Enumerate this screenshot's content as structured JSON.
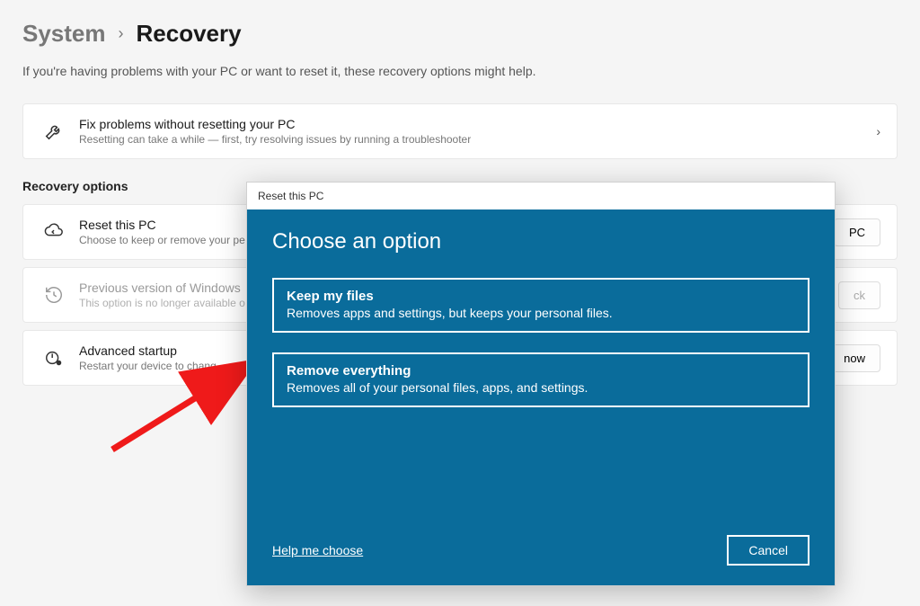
{
  "breadcrumb": {
    "parent": "System",
    "separator": "›",
    "current": "Recovery"
  },
  "subtitle": "If you're having problems with your PC or want to reset it, these recovery options might help.",
  "fix_card": {
    "title": "Fix problems without resetting your PC",
    "desc": "Resetting can take a while — first, try resolving issues by running a troubleshooter"
  },
  "section_title": "Recovery options",
  "reset_card": {
    "title": "Reset this PC",
    "desc": "Choose to keep or remove your pe",
    "button": "PC"
  },
  "previous_card": {
    "title": "Previous version of Windows",
    "desc": "This option is no longer available o",
    "button": "ck"
  },
  "advanced_card": {
    "title": "Advanced startup",
    "desc": "Restart your device to chang",
    "button": "now"
  },
  "dialog": {
    "head": "Reset this PC",
    "title": "Choose an option",
    "options": [
      {
        "title": "Keep my files",
        "desc": "Removes apps and settings, but keeps your personal files."
      },
      {
        "title": "Remove everything",
        "desc": "Removes all of your personal files, apps, and settings."
      }
    ],
    "help": "Help me choose",
    "cancel": "Cancel"
  }
}
